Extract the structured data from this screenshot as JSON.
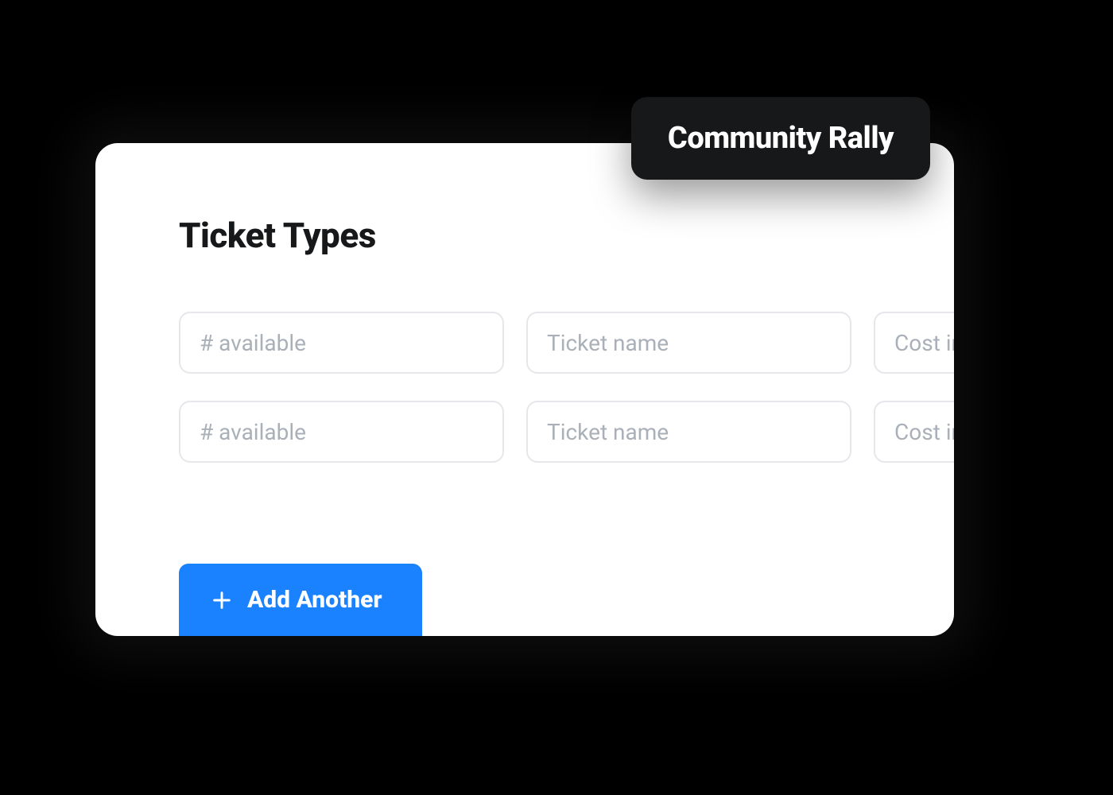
{
  "badge": {
    "label": "Community Rally"
  },
  "card": {
    "title": "Ticket Types",
    "rows": [
      {
        "available_placeholder": "# available",
        "name_placeholder": "Ticket name",
        "cost_placeholder": "Cost in USD",
        "available_value": "",
        "name_value": "",
        "cost_value": ""
      },
      {
        "available_placeholder": "# available",
        "name_placeholder": "Ticket name",
        "cost_placeholder": "Cost in USD",
        "available_value": "",
        "name_value": "",
        "cost_value": ""
      }
    ],
    "add_button_label": "Add Another"
  },
  "colors": {
    "accent": "#1a82ff",
    "card_bg": "#ffffff",
    "page_bg": "#000000",
    "badge_bg": "#17181a",
    "border": "#e5e7eb",
    "placeholder": "#aab0b8"
  }
}
